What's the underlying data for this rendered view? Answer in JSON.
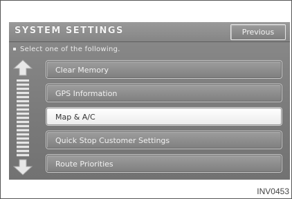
{
  "header": {
    "title": "SYSTEM SETTINGS",
    "previous_label": "Previous"
  },
  "instructions": "Select one of the following.",
  "menu": {
    "items": [
      {
        "label": "Clear Memory",
        "selected": false
      },
      {
        "label": "GPS Information",
        "selected": false
      },
      {
        "label": "Map & A/C",
        "selected": true
      },
      {
        "label": "Quick Stop Customer Settings",
        "selected": false
      },
      {
        "label": "Route Priorities",
        "selected": false
      }
    ]
  },
  "scroll": {
    "up_icon": "arrow-up-icon",
    "down_icon": "arrow-down-icon"
  },
  "figure_code": "INV0453",
  "colors": {
    "screen_bg": "#7f7f7f",
    "button_bg": "#8e8e8e",
    "selected_bg": "#ffffff",
    "text_light": "#f1f1f1"
  }
}
